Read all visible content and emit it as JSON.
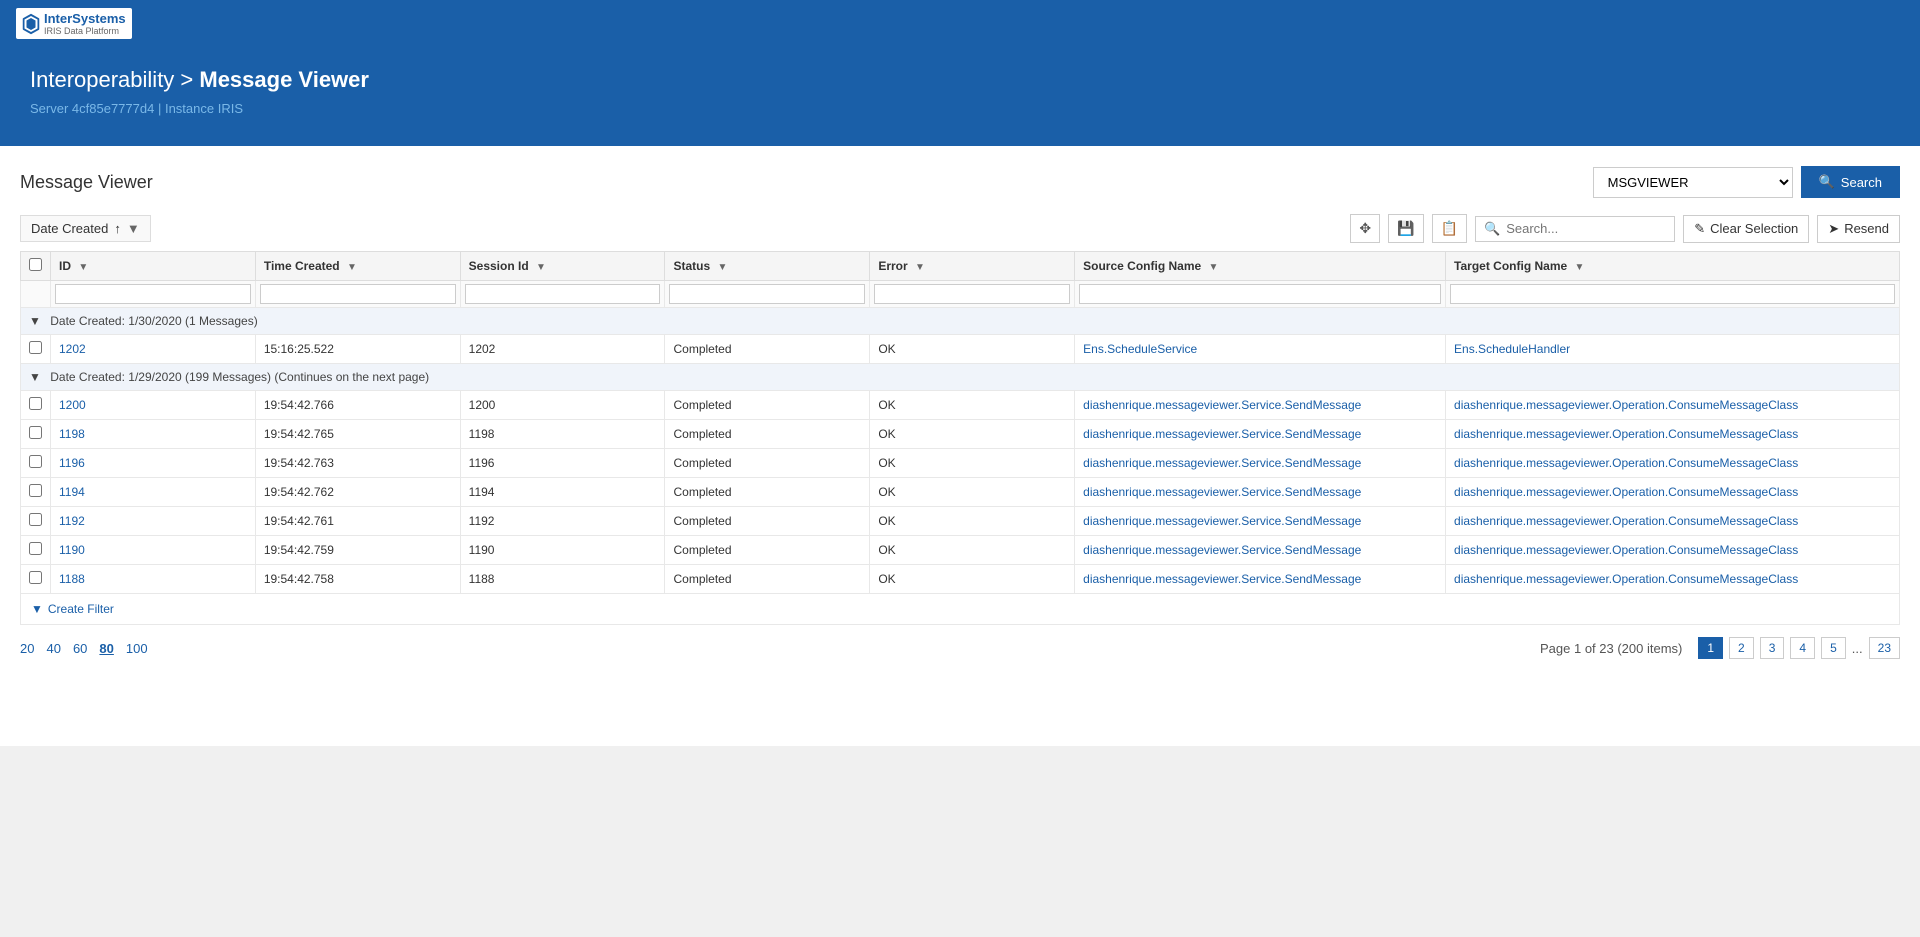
{
  "topNav": {
    "logoText": "InterSystems",
    "logoSub": "IRIS Data Platform"
  },
  "header": {
    "breadcrumb": "Interoperability > Message Viewer",
    "breadcrumb_prefix": "Interoperability > ",
    "breadcrumb_bold": "Message Viewer",
    "serverLabel": "Server",
    "serverValue": "4cf85e7777d4",
    "instanceLabel": "Instance",
    "instanceValue": "IRIS"
  },
  "page": {
    "title": "Message Viewer",
    "namespace": "MSGVIEWER",
    "searchLabel": "Search"
  },
  "toolbar": {
    "sortLabel": "Date Created",
    "sortArrow": "↑",
    "searchPlaceholder": "Search...",
    "clearSelectionLabel": "Clear Selection",
    "resendLabel": "Resend"
  },
  "table": {
    "columns": [
      {
        "id": "checkbox",
        "label": "",
        "filterable": false
      },
      {
        "id": "id",
        "label": "ID",
        "filterable": true
      },
      {
        "id": "timeCreated",
        "label": "Time Created",
        "filterable": true
      },
      {
        "id": "sessionId",
        "label": "Session Id",
        "filterable": true
      },
      {
        "id": "status",
        "label": "Status",
        "filterable": true
      },
      {
        "id": "error",
        "label": "Error",
        "filterable": true
      },
      {
        "id": "sourceConfigName",
        "label": "Source Config Name",
        "filterable": true
      },
      {
        "id": "targetConfigName",
        "label": "Target Config Name",
        "filterable": true
      }
    ],
    "groups": [
      {
        "label": "Date Created: 1/30/2020 (1 Messages)",
        "rows": [
          {
            "id": "1202",
            "timeCreated": "15:16:25.522",
            "sessionId": "1202",
            "status": "Completed",
            "error": "OK",
            "sourceConfigName": "Ens.ScheduleService",
            "targetConfigName": "Ens.ScheduleHandler"
          }
        ]
      },
      {
        "label": "Date Created: 1/29/2020 (199 Messages) (Continues on the next page)",
        "rows": [
          {
            "id": "1200",
            "timeCreated": "19:54:42.766",
            "sessionId": "1200",
            "status": "Completed",
            "error": "OK",
            "sourceConfigName": "diashenrique.messageviewer.Service.SendMessage",
            "targetConfigName": "diashenrique.messageviewer.Operation.ConsumeMessageClass"
          },
          {
            "id": "1198",
            "timeCreated": "19:54:42.765",
            "sessionId": "1198",
            "status": "Completed",
            "error": "OK",
            "sourceConfigName": "diashenrique.messageviewer.Service.SendMessage",
            "targetConfigName": "diashenrique.messageviewer.Operation.ConsumeMessageClass"
          },
          {
            "id": "1196",
            "timeCreated": "19:54:42.763",
            "sessionId": "1196",
            "status": "Completed",
            "error": "OK",
            "sourceConfigName": "diashenrique.messageviewer.Service.SendMessage",
            "targetConfigName": "diashenrique.messageviewer.Operation.ConsumeMessageClass"
          },
          {
            "id": "1194",
            "timeCreated": "19:54:42.762",
            "sessionId": "1194",
            "status": "Completed",
            "error": "OK",
            "sourceConfigName": "diashenrique.messageviewer.Service.SendMessage",
            "targetConfigName": "diashenrique.messageviewer.Operation.ConsumeMessageClass"
          },
          {
            "id": "1192",
            "timeCreated": "19:54:42.761",
            "sessionId": "1192",
            "status": "Completed",
            "error": "OK",
            "sourceConfigName": "diashenrique.messageviewer.Service.SendMessage",
            "targetConfigName": "diashenrique.messageviewer.Operation.ConsumeMessageClass"
          },
          {
            "id": "1190",
            "timeCreated": "19:54:42.759",
            "sessionId": "1190",
            "status": "Completed",
            "error": "OK",
            "sourceConfigName": "diashenrique.messageviewer.Service.SendMessage",
            "targetConfigName": "diashenrique.messageviewer.Operation.ConsumeMessageClass"
          },
          {
            "id": "1188",
            "timeCreated": "19:54:42.758",
            "sessionId": "1188",
            "status": "Completed",
            "error": "OK",
            "sourceConfigName": "diashenrique.messageviewer.Service.SendMessage",
            "targetConfigName": "diashenrique.messageviewer.Operation.ConsumeMessageClass"
          }
        ]
      }
    ]
  },
  "createFilter": {
    "label": "Create Filter"
  },
  "pagination": {
    "pageSizes": [
      "20",
      "40",
      "60",
      "80",
      "100"
    ],
    "pageInfo": "Page 1 of 23 (200 items)",
    "pages": [
      "1",
      "2",
      "3",
      "4",
      "5"
    ],
    "dots": "...",
    "lastPage": "23",
    "activePage": "1"
  }
}
